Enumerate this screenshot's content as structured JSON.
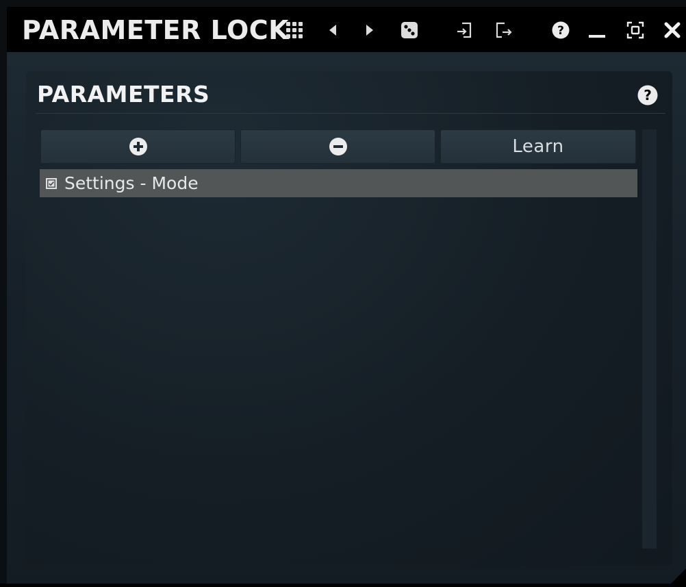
{
  "window": {
    "title": "PARAMETER LOCK",
    "toolbar": [
      {
        "icon": "grid-menu-icon"
      },
      {
        "icon": "arrow-left-icon"
      },
      {
        "icon": "arrow-right-icon"
      },
      {
        "icon": "dice-icon"
      },
      {
        "icon": "import-icon"
      },
      {
        "icon": "export-icon"
      },
      {
        "icon": "help-icon"
      },
      {
        "icon": "minimize-icon"
      },
      {
        "icon": "maximize-icon"
      },
      {
        "icon": "close-icon"
      }
    ]
  },
  "panel": {
    "title": "PARAMETERS",
    "help_icon": "help-icon",
    "buttons": {
      "add_icon": "plus-circle-icon",
      "remove_icon": "minus-circle-icon",
      "learn_label": "Learn"
    },
    "items": [
      {
        "label": "Settings - Mode",
        "checked": true
      }
    ]
  },
  "colors": {
    "titlebar_bg": "#000000",
    "panel_bg": "#151e25",
    "button_bg": "#2c3a44",
    "selected_row": "#525657",
    "text": "#ececec"
  }
}
